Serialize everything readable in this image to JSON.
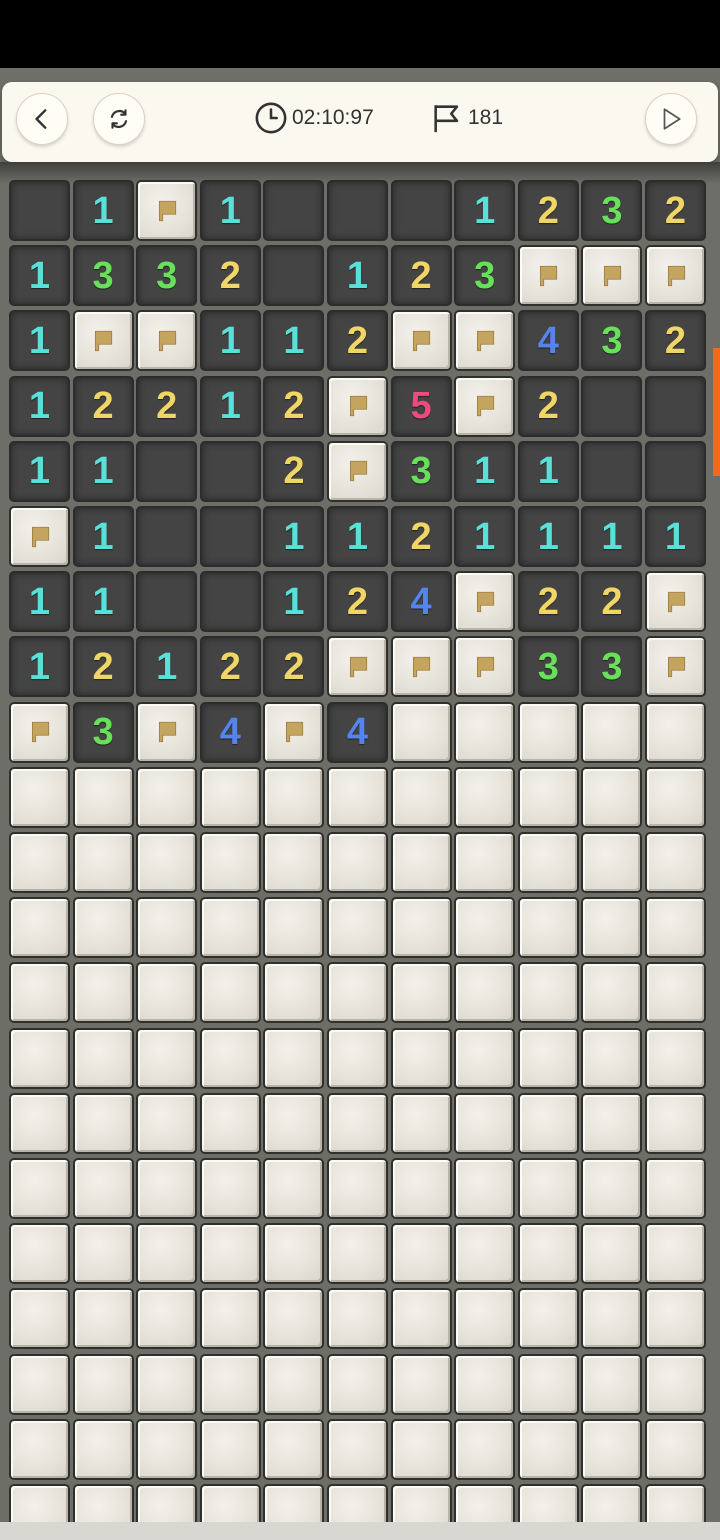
{
  "header": {
    "timer": "02:10:97",
    "flag_count": "181"
  },
  "colors": {
    "1": "#59e1d9",
    "2": "#f0d567",
    "3": "#68e05a",
    "4": "#5584ea",
    "5": "#ec4b7d",
    "flag": "#c4a45f",
    "accent": "#ee6a1d"
  },
  "board": {
    "rows": [
      [
        "o",
        "1",
        "F",
        "1",
        "o",
        "o",
        "o",
        "1",
        "2",
        "3",
        "2"
      ],
      [
        "1",
        "3",
        "3",
        "2",
        "o",
        "1",
        "2",
        "3",
        "F",
        "F",
        "F"
      ],
      [
        "1",
        "F",
        "F",
        "1",
        "1",
        "2",
        "F",
        "F",
        "4",
        "3",
        "2"
      ],
      [
        "1",
        "2",
        "2",
        "1",
        "2",
        "F",
        "5",
        "F",
        "2",
        "o",
        "o"
      ],
      [
        "1",
        "1",
        "o",
        "o",
        "2",
        "F",
        "3",
        "1",
        "1",
        "o",
        "o"
      ],
      [
        "F",
        "1",
        "o",
        "o",
        "1",
        "1",
        "2",
        "1",
        "1",
        "1",
        "1"
      ],
      [
        "1",
        "1",
        "o",
        "o",
        "1",
        "2",
        "4",
        "F",
        "2",
        "2",
        "F"
      ],
      [
        "1",
        "2",
        "1",
        "2",
        "2",
        "F",
        "F",
        "F",
        "3",
        "3",
        "F"
      ],
      [
        "F",
        "3",
        "F",
        "4",
        "F",
        "4",
        "c",
        "c",
        "c",
        "c",
        "c"
      ],
      [
        "c",
        "c",
        "c",
        "c",
        "c",
        "c",
        "c",
        "c",
        "c",
        "c",
        "c"
      ],
      [
        "c",
        "c",
        "c",
        "c",
        "c",
        "c",
        "c",
        "c",
        "c",
        "c",
        "c"
      ],
      [
        "c",
        "c",
        "c",
        "c",
        "c",
        "c",
        "c",
        "c",
        "c",
        "c",
        "c"
      ],
      [
        "c",
        "c",
        "c",
        "c",
        "c",
        "c",
        "c",
        "c",
        "c",
        "c",
        "c"
      ],
      [
        "c",
        "c",
        "c",
        "c",
        "c",
        "c",
        "c",
        "c",
        "c",
        "c",
        "c"
      ],
      [
        "c",
        "c",
        "c",
        "c",
        "c",
        "c",
        "c",
        "c",
        "c",
        "c",
        "c"
      ],
      [
        "c",
        "c",
        "c",
        "c",
        "c",
        "c",
        "c",
        "c",
        "c",
        "c",
        "c"
      ],
      [
        "c",
        "c",
        "c",
        "c",
        "c",
        "c",
        "c",
        "c",
        "c",
        "c",
        "c"
      ],
      [
        "c",
        "c",
        "c",
        "c",
        "c",
        "c",
        "c",
        "c",
        "c",
        "c",
        "c"
      ],
      [
        "c",
        "c",
        "c",
        "c",
        "c",
        "c",
        "c",
        "c",
        "c",
        "c",
        "c"
      ],
      [
        "c",
        "c",
        "c",
        "c",
        "c",
        "c",
        "c",
        "c",
        "c",
        "c",
        "c"
      ],
      [
        "c",
        "c",
        "c",
        "c",
        "c",
        "c",
        "c",
        "c",
        "c",
        "c",
        "c"
      ],
      [
        "c",
        "c",
        "c",
        "c",
        "c",
        "c",
        "c",
        "c",
        "c",
        "c",
        "c"
      ]
    ]
  }
}
